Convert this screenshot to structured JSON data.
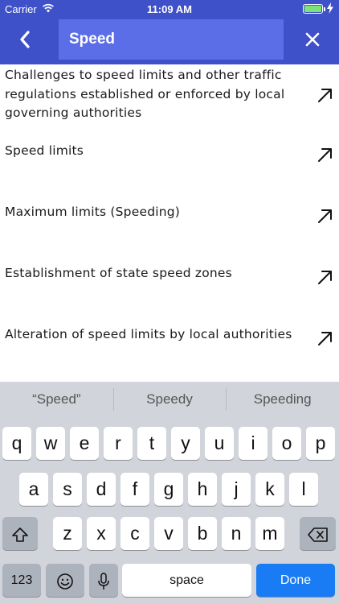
{
  "status_bar": {
    "carrier": "Carrier",
    "time": "11:09 AM",
    "battery_level": 1.0,
    "battery_color": "#7CE37C"
  },
  "header": {
    "background": "#3F51C9",
    "search_value": "Speed",
    "back_icon": "chevron-left-icon",
    "clear_icon": "close-icon"
  },
  "results": [
    {
      "text": "Challenges to speed limits and other traffic regulations established or enforced by local governing authorities",
      "icon": "arrow-up-right-icon"
    },
    {
      "text": "Speed limits",
      "icon": "arrow-up-right-icon"
    },
    {
      "text": "Maximum limits (Speeding)",
      "icon": "arrow-up-right-icon"
    },
    {
      "text": "Establishment of state speed zones",
      "icon": "arrow-up-right-icon"
    },
    {
      "text": "Alteration of speed limits by local authorities",
      "icon": "arrow-up-right-icon"
    }
  ],
  "keyboard": {
    "suggestions": [
      "“Speed”",
      "Speedy",
      "Speeding"
    ],
    "row1": [
      "q",
      "w",
      "e",
      "r",
      "t",
      "y",
      "u",
      "i",
      "o",
      "p"
    ],
    "row2": [
      "a",
      "s",
      "d",
      "f",
      "g",
      "h",
      "j",
      "k",
      "l"
    ],
    "row3": [
      "z",
      "x",
      "c",
      "v",
      "b",
      "n",
      "m"
    ],
    "numbers_label": "123",
    "space_label": "space",
    "done_label": "Done",
    "done_color": "#1A7CF5"
  }
}
